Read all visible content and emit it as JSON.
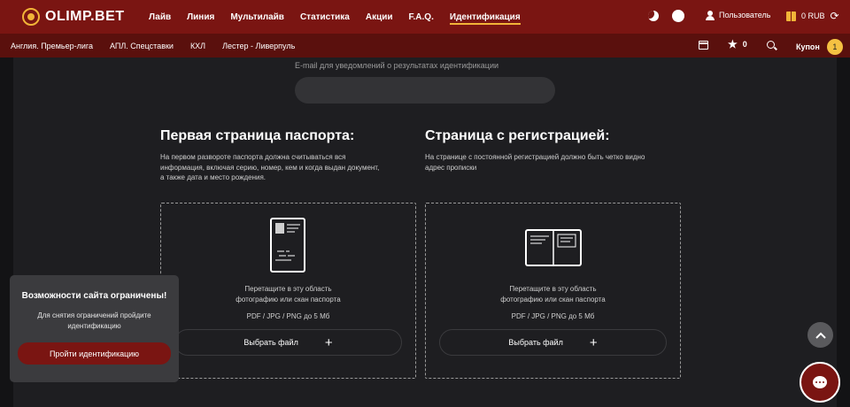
{
  "header": {
    "logo": "OLIMP.BET",
    "nav": [
      "Лайв",
      "Линия",
      "Мультилайв",
      "Статистика",
      "Акции",
      "F.A.Q.",
      "Идентификация"
    ],
    "active_nav": "Идентификация",
    "user": "Пользователь",
    "balance": "0 RUB"
  },
  "subnav": {
    "items": [
      "Англия. Премьер-лига",
      "АПЛ. Спецставки",
      "КХЛ",
      "Лестер - Ливерпуль"
    ],
    "favorites_count": "0",
    "coupon_label": "Купон",
    "coupon_count": "1"
  },
  "email": {
    "label": "E-mail для уведомлений о результатах идентификации",
    "value": ""
  },
  "passport_main": {
    "title": "Первая страница паспорта:",
    "desc_lines": [
      "На первом развороте паспорта должна считываться вся",
      "информация, включая серию, номер, кем и когда выдан документ,",
      "а также дата и место рождения."
    ],
    "drop_lines": [
      "Перетащите в эту область",
      "фотографию или скан паспорта"
    ],
    "formats": "PDF / JPG / PNG до 5 Мб",
    "button": "Выбрать файл"
  },
  "passport_reg": {
    "title": "Страница с регистрацией:",
    "desc_lines": [
      "На странице с постоянной регистрацией должно быть четко видно",
      "адрес прописки"
    ],
    "drop_lines": [
      "Перетащите в эту область",
      "фотографию или скан паспорта"
    ],
    "formats": "PDF / JPG / PNG до 5 Мб",
    "button": "Выбрать файл"
  },
  "restriction": {
    "title": "Возможности сайта ограничены!",
    "text_lines": [
      "Для снятия ограничений пройдите",
      "идентификацию"
    ],
    "button": "Пройти идентификацию"
  },
  "colors": {
    "header": "#7a1512",
    "subheader": "#5a100d",
    "accent": "#f2b438",
    "background": "#131315",
    "panel": "#1e1e21"
  }
}
